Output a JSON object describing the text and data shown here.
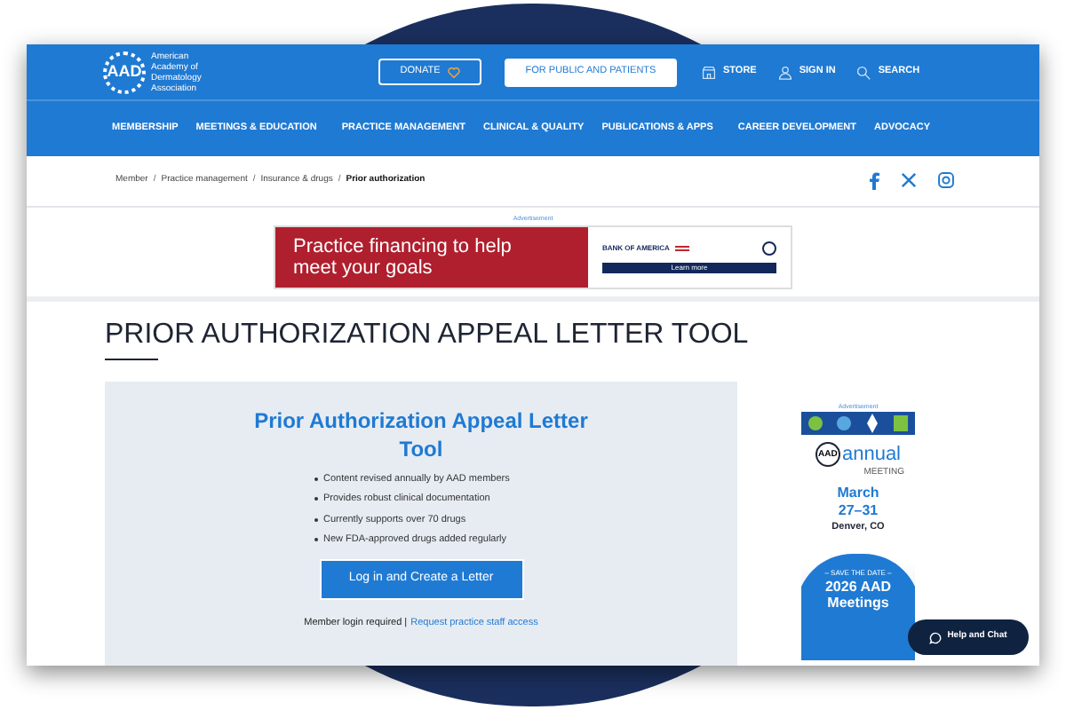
{
  "logo": {
    "mark": "AAD",
    "name": "American Academy of Dermatology Association"
  },
  "top_bar": {
    "donate": "DONATE",
    "public_button": "FOR PUBLIC AND PATIENTS",
    "links": [
      {
        "kind": "store",
        "label": "STORE"
      },
      {
        "kind": "user",
        "label": "SIGN IN"
      },
      {
        "kind": "search",
        "label": "SEARCH"
      }
    ]
  },
  "nav": [
    "MEMBERSHIP",
    "MEETINGS & EDUCATION",
    "PRACTICE MANAGEMENT",
    "CLINICAL & QUALITY",
    "PUBLICATIONS & APPS",
    "CAREER DEVELOPMENT",
    "ADVOCACY"
  ],
  "breadcrumb": [
    {
      "label": "Member",
      "selected": false,
      "separator": "/"
    },
    {
      "label": "Practice management",
      "selected": false,
      "separator": "/"
    },
    {
      "label": "Insurance & drugs",
      "selected": false,
      "separator": "/"
    },
    {
      "label": "Prior authorization",
      "selected": true
    }
  ],
  "social": [
    {
      "kind": "facebook"
    },
    {
      "kind": "x"
    },
    {
      "kind": "instagram"
    }
  ],
  "banner_ad": {
    "label": "Advertisement",
    "headline": "Practice financing to help meet your goals",
    "brand": "BANK OF AMERICA",
    "cta": "Learn more"
  },
  "page_title": "PRIOR AUTHORIZATION APPEAL LETTER TOOL",
  "tool_card": {
    "title": "Prior Authorization Appeal Letter Tool",
    "bullets": [
      "Content revised annually by AAD members",
      "Provides robust clinical documentation",
      "Currently supports over 70 drugs",
      "New FDA-approved drugs added regularly"
    ],
    "button": "Log in and Create a Letter",
    "note": "Member login required |",
    "link": "Request practice staff access"
  },
  "side_ad": {
    "label": "Advertisement",
    "logo_mark": "AAD",
    "event": "annual",
    "event_sub": "MEETING",
    "month": "March",
    "days": "27–31",
    "place": "Denver, CO",
    "save": "– SAVE THE DATE –",
    "headline": "2026 AAD Meetings"
  },
  "chat_button": "Help and Chat"
}
